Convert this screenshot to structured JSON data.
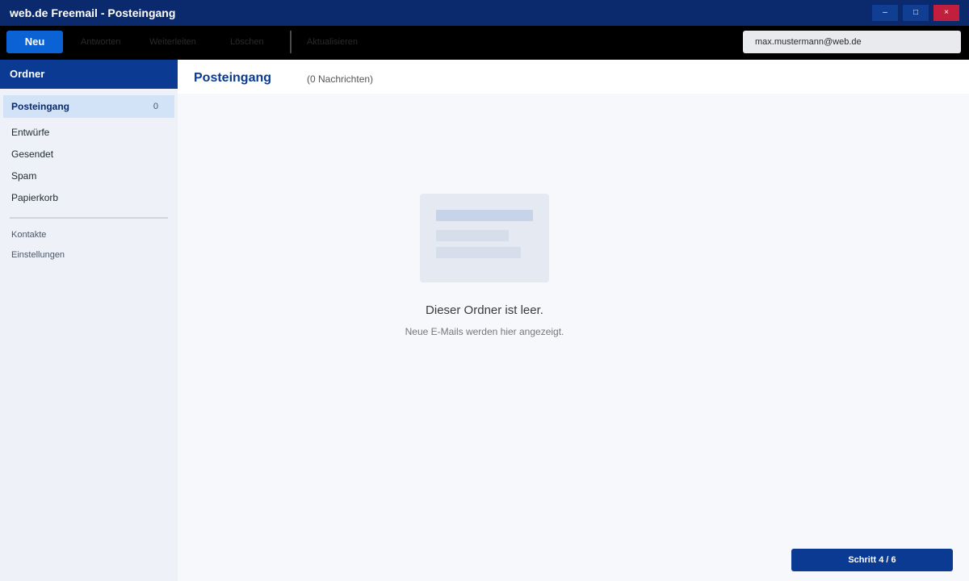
{
  "window": {
    "title": "web.de Freemail - Posteingang",
    "min_label": "–",
    "max_label": "□",
    "close_label": "×"
  },
  "toolbar": {
    "new_label": "Neu",
    "reply_label": "Antworten",
    "forward_label": "Weiterleiten",
    "delete_label": "Löschen",
    "refresh_label": "Aktualisieren",
    "account": "max.mustermann@web.de"
  },
  "sidebar": {
    "header": "Ordner",
    "folders": [
      {
        "label": "Posteingang",
        "count": "0"
      },
      {
        "label": "Entwürfe"
      },
      {
        "label": "Gesendet"
      },
      {
        "label": "Spam"
      },
      {
        "label": "Papierkorb"
      }
    ],
    "links": [
      {
        "label": "Kontakte"
      },
      {
        "label": "Einstellungen"
      }
    ]
  },
  "main": {
    "title": "Posteingang",
    "count_text": "(0 Nachrichten)",
    "empty_title": "Dieser Ordner ist leer.",
    "empty_subtitle": "Neue E-Mails werden hier angezeigt."
  },
  "step": {
    "label": "Schritt 4 / 6"
  },
  "colors": {
    "titlebar": "#0b2a6e",
    "accent": "#0b62d4",
    "sidebar_header": "#0b3a93",
    "close": "#c21f3e"
  }
}
